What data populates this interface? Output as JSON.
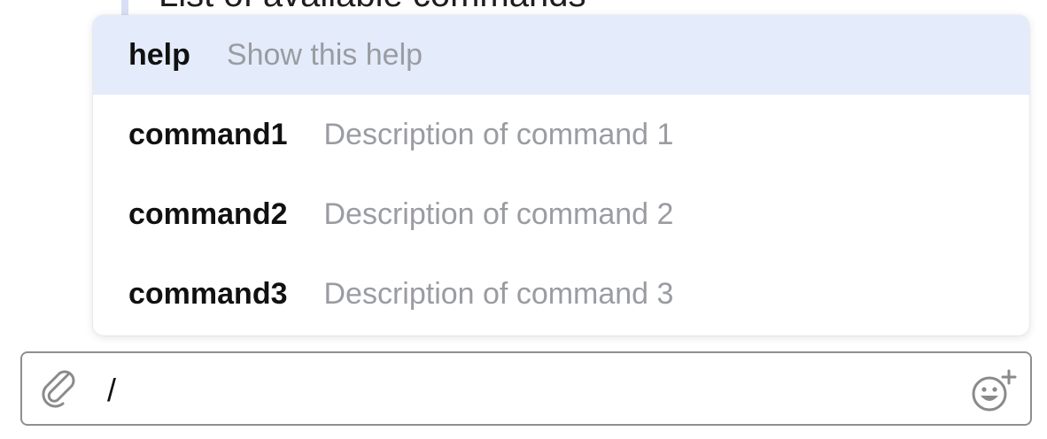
{
  "background_message": {
    "text": "List of available commands"
  },
  "command_popup": {
    "items": [
      {
        "name": "help",
        "description": "Show this help",
        "selected": true
      },
      {
        "name": "command1",
        "description": "Description of command 1",
        "selected": false
      },
      {
        "name": "command2",
        "description": "Description of command 2",
        "selected": false
      },
      {
        "name": "command3",
        "description": "Description of command 3",
        "selected": false
      }
    ]
  },
  "composer": {
    "value": "/",
    "attach_icon": "paperclip-icon",
    "emoji_icon": "emoji-add-icon"
  },
  "colors": {
    "selected_row": "#e4ecfb",
    "description_text": "#9a9ca2",
    "quote_bar": "#d9dff5",
    "input_border": "#8f8f8f"
  }
}
